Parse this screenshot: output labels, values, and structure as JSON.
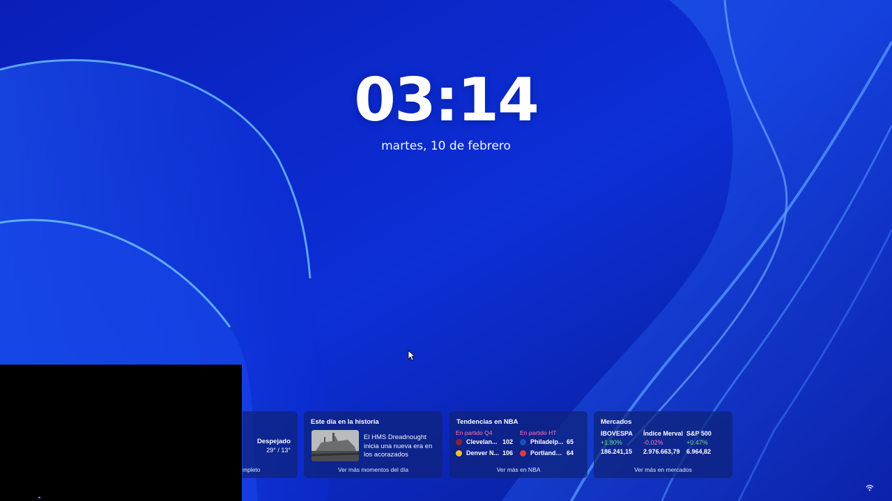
{
  "lockscreen": {
    "time": "03:14",
    "date": "martes, 10 de febrero"
  },
  "widgets": {
    "weather": {
      "condition": "Despejado",
      "temps": "29° / 13°",
      "footer": "mpleto"
    },
    "history": {
      "title": "Este día en la historia",
      "headline": "El HMS Dreadnought inicia una nueva era en los acorazados",
      "footer": "Ver más momentos del día"
    },
    "nba": {
      "title": "Tendencias en NBA",
      "games": [
        {
          "status": "En partido Q4",
          "teams": [
            {
              "name": "Clevelan...",
              "score": "102",
              "logo_color": "#8a2432"
            },
            {
              "name": "Denver N...",
              "score": "106",
              "logo_color": "#f2c12e"
            }
          ]
        },
        {
          "status": "En partido HT",
          "teams": [
            {
              "name": "Philadelp...",
              "score": "65",
              "logo_color": "#1e4fb8"
            },
            {
              "name": "Portland T...",
              "score": "64",
              "logo_color": "#e03a3e"
            }
          ]
        }
      ],
      "footer": "Ver más en NBA"
    },
    "markets": {
      "title": "Mercados",
      "items": [
        {
          "name": "IBOVESPA",
          "change": "+1.80%",
          "direction": "up",
          "value": "186.241,15"
        },
        {
          "name": "Índice Merval",
          "change": "-0,02%",
          "direction": "down",
          "value": "2.976.663,79"
        },
        {
          "name": "S&P 500",
          "change": "+0.47%",
          "direction": "up",
          "value": "6.964,82"
        }
      ],
      "footer": "Ver más en mercados"
    }
  },
  "colors": {
    "positive": "#6ee07a",
    "negative": "#ff7ab6",
    "card_bg": "#0e2278"
  },
  "icons": {
    "status_tray": "wifi-icon",
    "cursor": "mouse-pointer-icon"
  }
}
